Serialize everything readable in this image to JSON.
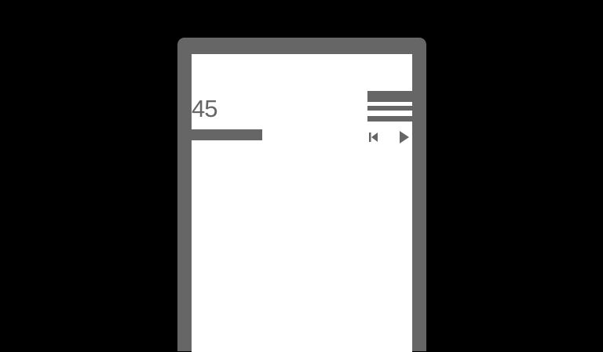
{
  "player": {
    "count": "45",
    "progress_fraction": 0.45
  },
  "icons": {
    "menu": "hamburger-menu-icon",
    "previous": "skip-previous-icon",
    "play": "play-icon"
  },
  "colors": {
    "background": "#000000",
    "device": "#666666",
    "screen": "#ffffff",
    "accent": "#666666"
  }
}
